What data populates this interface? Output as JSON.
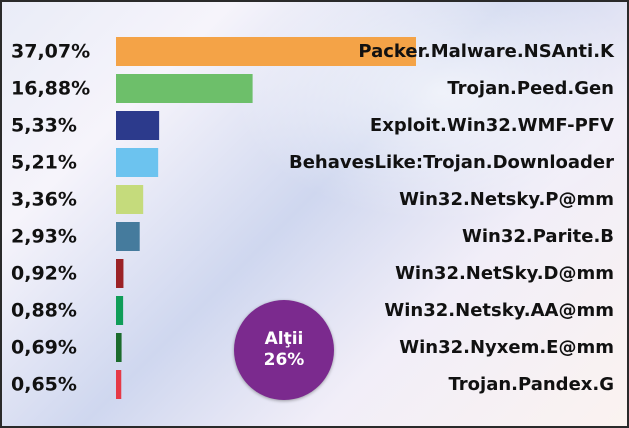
{
  "chart_data": {
    "type": "bar",
    "orientation": "horizontal",
    "categories": [
      "Packer.Malware.NSAnti.K",
      "Trojan.Peed.Gen",
      "Exploit.Win32.WMF-PFV",
      "BehavesLike:Trojan.Downloader",
      "Win32.Netsky.P@mm",
      "Win32.Parite.B",
      "Win32.NetSky.D@mm",
      "Win32.Netsky.AA@mm",
      "Win32.Nyxem.E@mm",
      "Trojan.Pandex.G"
    ],
    "value_labels": [
      "37,07%",
      "16,88%",
      "5,33%",
      "5,21%",
      "3,36%",
      "2,93%",
      "0,92%",
      "0,88%",
      "0,69%",
      "0,65%"
    ],
    "values": [
      37.07,
      16.88,
      5.33,
      5.21,
      3.36,
      2.93,
      0.92,
      0.88,
      0.69,
      0.65
    ],
    "unit": "%",
    "colors": [
      "#f4a347",
      "#6dbf6a",
      "#2c3a8c",
      "#6cc3ef",
      "#c5db7c",
      "#457b9d",
      "#9b2226",
      "#0f9d58",
      "#1b6b2c",
      "#e63946"
    ],
    "grid": false,
    "legend": "none"
  },
  "others": {
    "label": "Alţii",
    "value_label": "26%",
    "value": 26,
    "color": "#7b2a8e"
  }
}
